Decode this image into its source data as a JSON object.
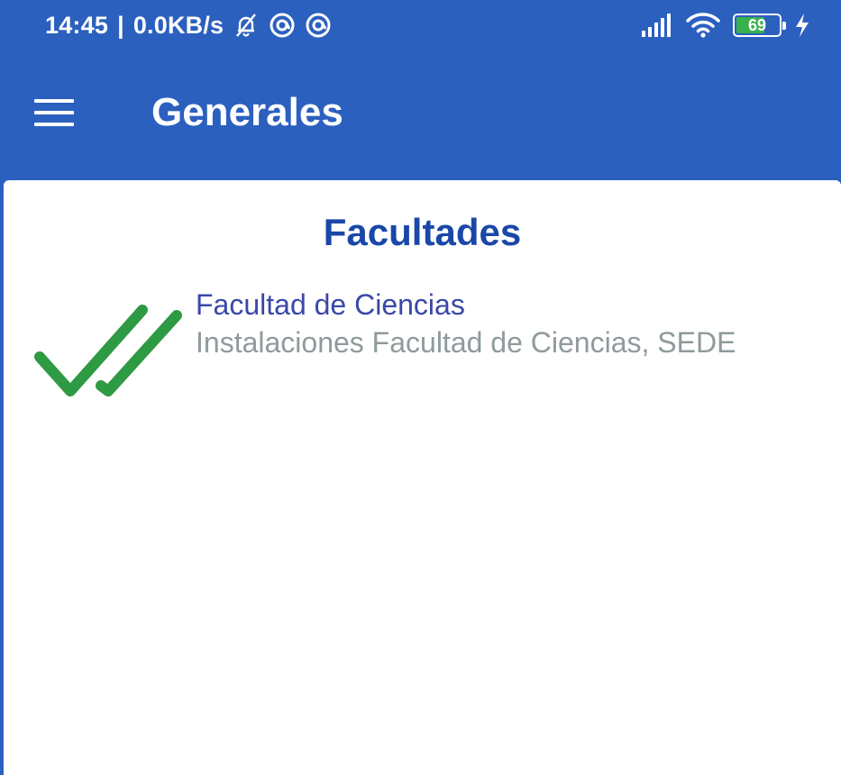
{
  "status_bar": {
    "time": "14:45",
    "speed": "0.0KB/s",
    "battery_level": "69",
    "battery_color": "#37b24d"
  },
  "toolbar": {
    "menu_icon": "hamburger-icon",
    "title": "Generales",
    "background_color": "#2c60bf"
  },
  "content": {
    "section_title": "Facultades",
    "items": [
      {
        "icon": "double-check-icon",
        "title": "Facultad de Ciencias",
        "subtitle": "Instalaciones Facultad de Ciencias, SEDE"
      }
    ]
  }
}
